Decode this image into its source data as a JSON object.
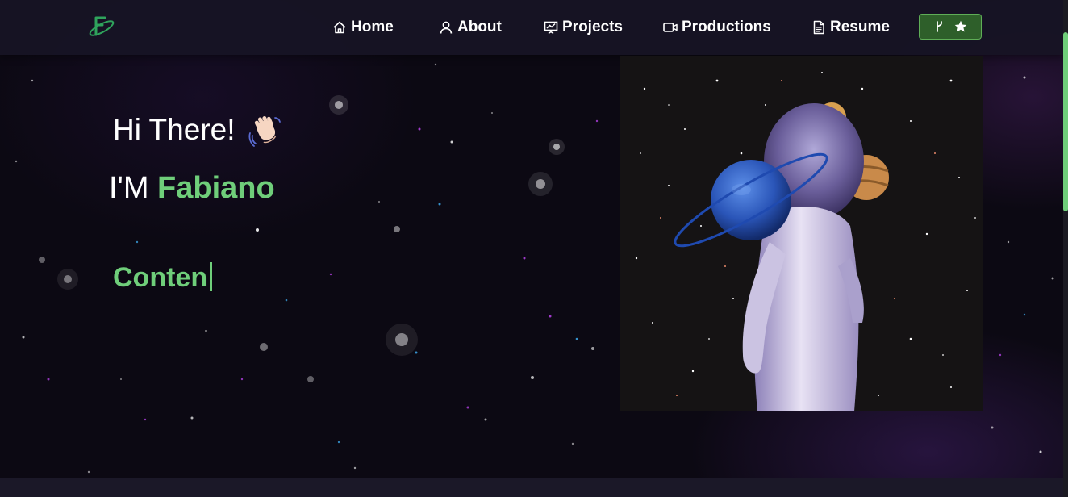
{
  "nav": {
    "brand_icon": "logo-icon",
    "items": [
      {
        "label": "Home",
        "icon": "home-icon"
      },
      {
        "label": "About",
        "icon": "user-icon"
      },
      {
        "label": "Projects",
        "icon": "presentation-icon"
      },
      {
        "label": "Productions",
        "icon": "video-icon"
      },
      {
        "label": "Resume",
        "icon": "document-icon"
      }
    ],
    "fork_button": {
      "icons": [
        "fork-icon",
        "star-icon"
      ]
    }
  },
  "hero": {
    "greeting": "Hi There!",
    "greeting_emoji": "wave-emoji",
    "intro_prefix": "I'M",
    "name": "Fabiano",
    "typewriter_text": "Conten",
    "image": "astronaut-planet-illustration"
  },
  "colors": {
    "accent": "#6fce7a",
    "nav_background": "#171424",
    "background": "#0c0913",
    "fork_button_bg": "#2e5f2a"
  }
}
